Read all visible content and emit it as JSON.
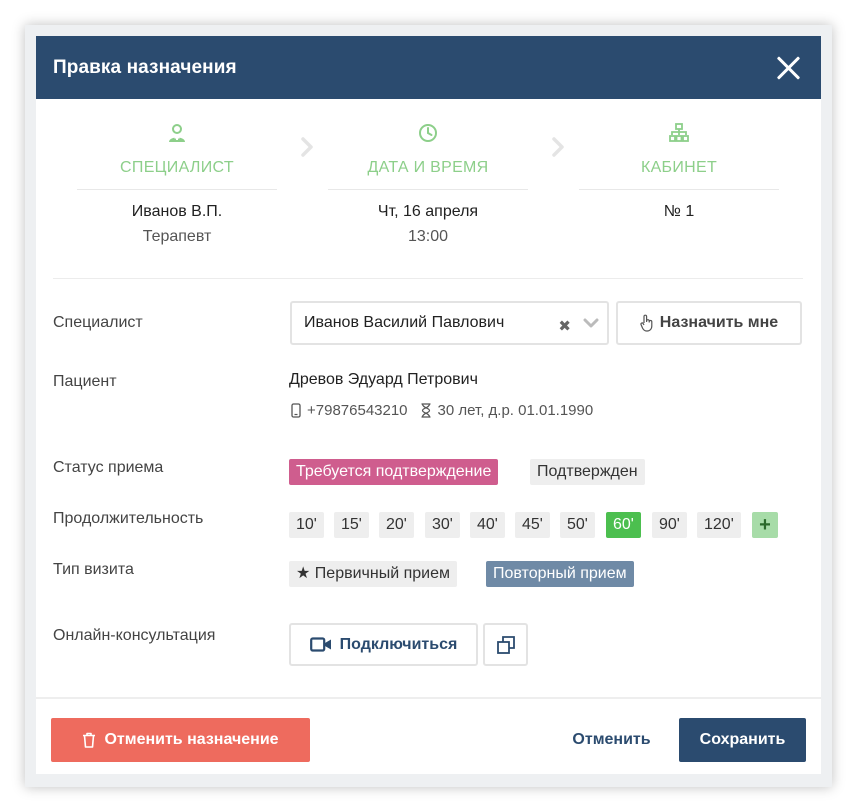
{
  "colors": {
    "header_bg": "#2b4b6f",
    "step_accent": "#8dcf8a",
    "status_pink": "#cf5d8e",
    "duration_selected": "#4cbf4f",
    "visit_selected": "#6f8aa6",
    "danger": "#ee6b5e"
  },
  "header": {
    "title": "Правка назначения",
    "close_icon": "close-icon"
  },
  "steps": [
    {
      "icon": "doctor-icon",
      "label": "СПЕЦИАЛИСТ",
      "value": "Иванов В.П.",
      "sub": "Терапевт"
    },
    {
      "icon": "clock-icon",
      "label": "ДАТА И ВРЕМЯ",
      "value": "Чт, 16 апреля",
      "sub": "13:00"
    },
    {
      "icon": "hierarchy-icon",
      "label": "КАБИНЕТ",
      "value": "№ 1",
      "sub": ""
    }
  ],
  "form": {
    "specialist": {
      "label": "Специалист",
      "selected": "Иванов Василий Павлович",
      "assign_me": "Назначить мне"
    },
    "patient": {
      "label": "Пациент",
      "name": "Древов Эдуард Петрович",
      "phone": "+79876543210",
      "age": "30 лет, д.р. 01.01.1990"
    },
    "status": {
      "label": "Статус приема",
      "options": [
        "Требуется подтверждение",
        "Подтвержден"
      ],
      "selected_index": 0
    },
    "duration": {
      "label": "Продолжительность",
      "options": [
        "10'",
        "15'",
        "20'",
        "30'",
        "40'",
        "45'",
        "50'",
        "60'",
        "90'",
        "120'"
      ],
      "selected_index": 7,
      "add_label": "+"
    },
    "visit_type": {
      "label": "Тип визита",
      "options": [
        "Первичный прием",
        "Повторный прием"
      ],
      "selected_index": 1
    },
    "online": {
      "label": "Онлайн-консультация",
      "connect": "Подключиться"
    }
  },
  "footer": {
    "cancel_appointment": "Отменить назначение",
    "cancel": "Отменить",
    "save": "Сохранить"
  }
}
